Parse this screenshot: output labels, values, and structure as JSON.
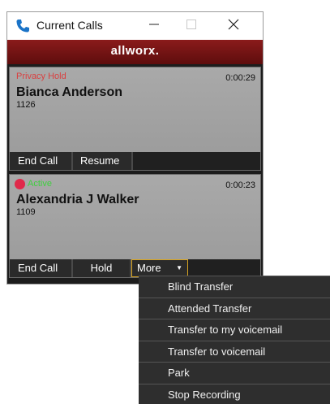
{
  "window": {
    "title": "Current Calls",
    "brand": "allworx."
  },
  "calls": [
    {
      "status": "Privacy Hold",
      "timer": "0:00:29",
      "name": "Bianca Anderson",
      "extension": "1126",
      "buttons": [
        "End Call",
        "Resume"
      ]
    },
    {
      "status": "Active",
      "timer": "0:00:23",
      "name": "Alexandria J Walker",
      "extension": "1109",
      "buttons": [
        "End Call",
        "Hold",
        "More"
      ]
    }
  ],
  "more_menu": [
    "Blind Transfer",
    "Attended Transfer",
    "Transfer to my voicemail",
    "Transfer to voicemail",
    "Park",
    "Stop Recording"
  ],
  "colors": {
    "brand_bar": "#7a1414",
    "privacy_hold": "#d94040",
    "active": "#3fcf3f",
    "active_dot": "#e0294a",
    "more_border": "#d9a520"
  },
  "icons": {
    "app": "phone-icon",
    "minimize": "minimize-icon",
    "maximize": "maximize-icon",
    "close": "close-icon",
    "more": "caret-down-icon"
  }
}
